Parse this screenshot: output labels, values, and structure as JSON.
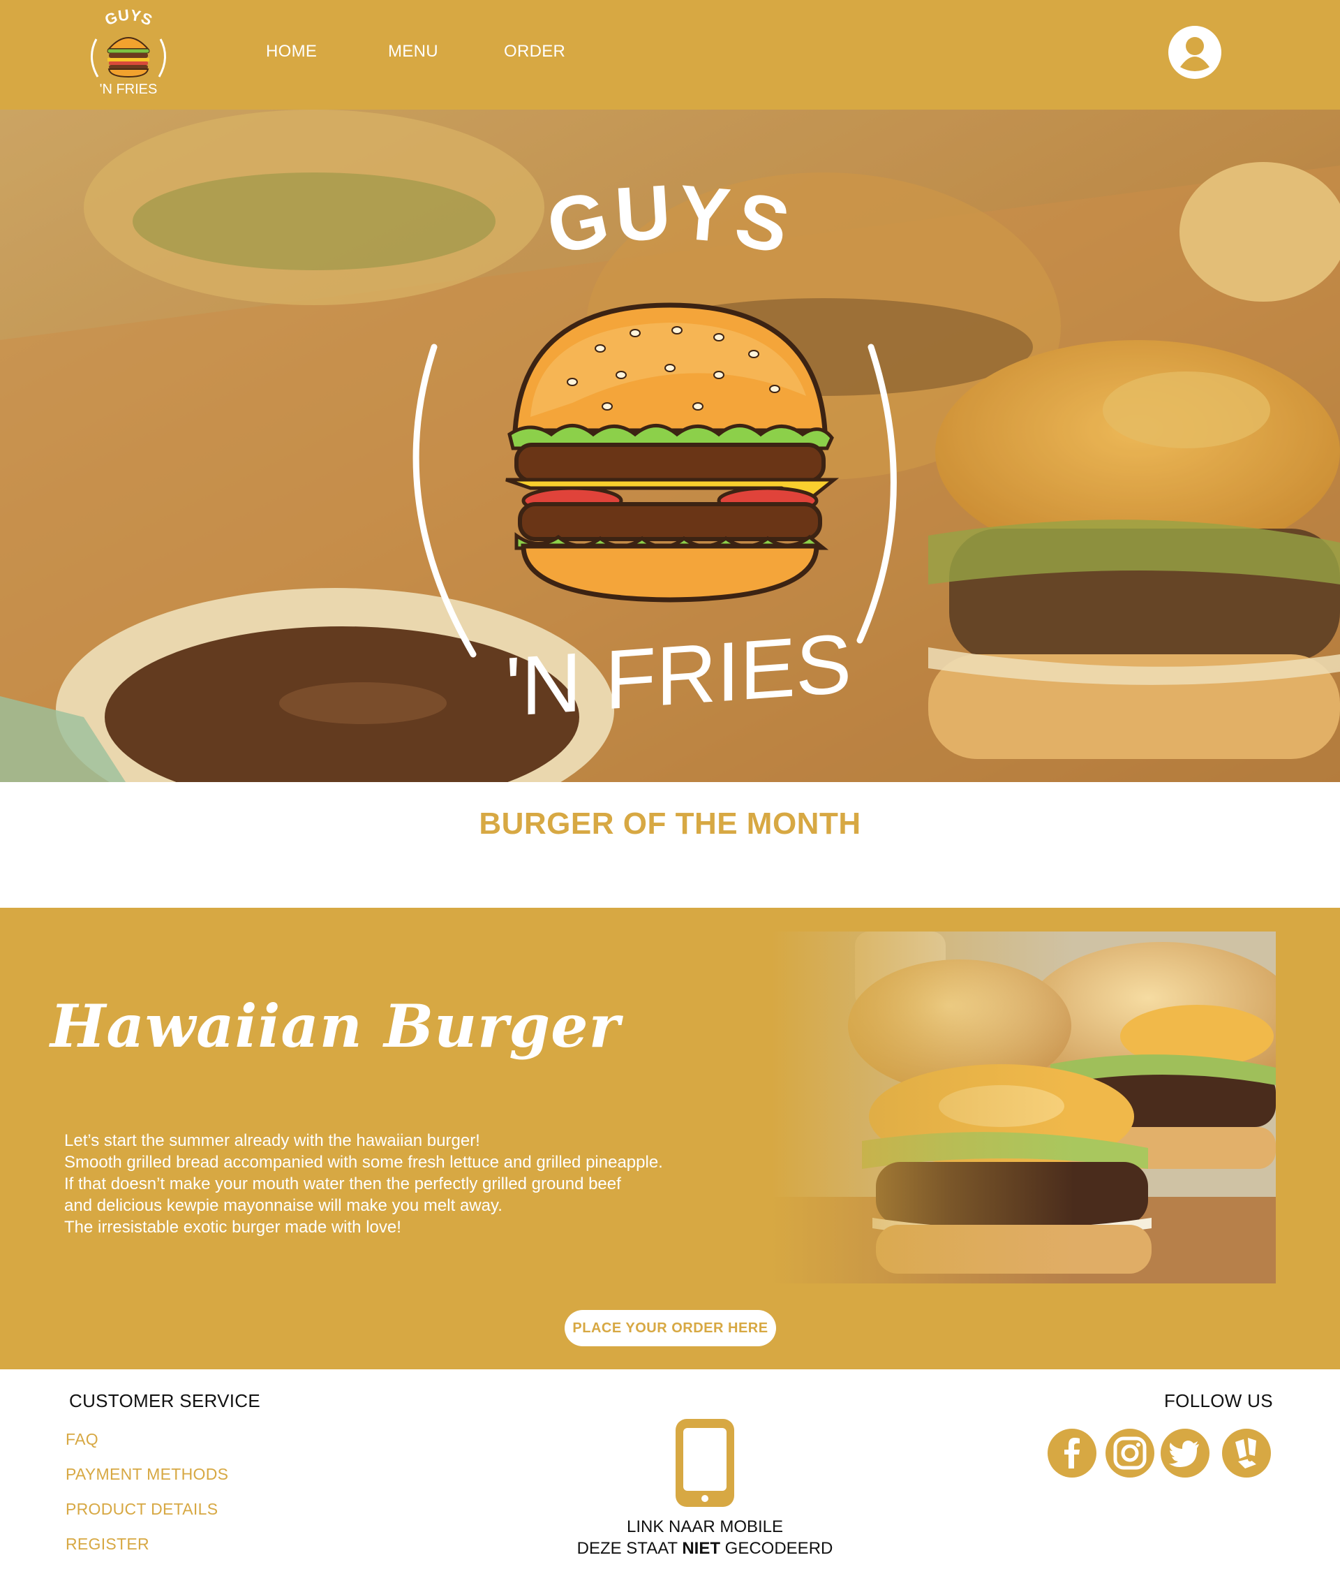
{
  "colors": {
    "brand": "#d7a843",
    "white": "#ffffff",
    "text_dark": "#111111"
  },
  "header": {
    "logo_top_text": "GUYS",
    "logo_bottom_text": "'N FRIES",
    "nav": [
      "HOME",
      "MENU",
      "ORDER"
    ],
    "profile_icon": "user-circle-icon"
  },
  "hero": {
    "logo_top_text": "GUYS",
    "logo_bottom_text": "'N FRIES"
  },
  "section_heading": "BURGER OF THE MONTH",
  "feature": {
    "title": "Hawaiian Burger",
    "description": [
      "Let’s start the summer already with the hawaiian burger!",
      "Smooth grilled bread accompanied with some fresh lettuce and grilled pineapple.",
      "If that doesn’t make your mouth water then the perfectly grilled ground beef",
      "and delicious kewpie mayonnaise will make you melt away.",
      "The irresistable exotic burger made with love!"
    ],
    "cta_label": "PLACE YOUR ORDER HERE"
  },
  "footer": {
    "customer_service": {
      "heading": "CUSTOMER SERVICE",
      "links": [
        "FAQ",
        "PAYMENT METHODS",
        "PRODUCT DETAILS",
        "REGISTER"
      ]
    },
    "mobile": {
      "icon": "smartphone-icon",
      "line1": "LINK NAAR MOBILE",
      "line2_before": "DEZE STAAT ",
      "line2_bold": "NIET",
      "line2_after": " GECODEERD"
    },
    "follow": {
      "heading": "FOLLOW US",
      "icons": [
        "facebook-icon",
        "instagram-icon",
        "twitter-icon",
        "deliveroo-icon"
      ]
    }
  }
}
